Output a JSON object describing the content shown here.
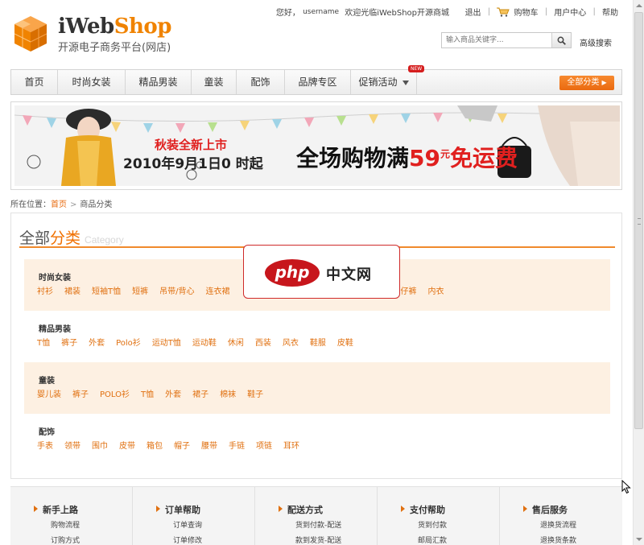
{
  "header": {
    "brand_prefix": "iWeb",
    "brand_suffix": "Shop",
    "subtitle": "开源电子商务平台(网店)",
    "greeting": "您好，",
    "username": "username",
    "welcome": "欢迎光临iWebShop开源商城",
    "links": {
      "logout": "退出",
      "cart": "购物车",
      "user_center": "用户中心",
      "help": "帮助"
    },
    "search": {
      "placeholder": "输入商品关键字...",
      "advanced": "高级搜索"
    }
  },
  "nav": {
    "items": [
      "首页",
      "时尚女装",
      "精品男装",
      "童装",
      "配饰",
      "品牌专区",
      "促销活动"
    ],
    "new_badge": "NEW",
    "all_categories": "全部分类"
  },
  "banner": {
    "line1": "秋装全新上市",
    "line2": "2010年9月1日0 时起",
    "promo_a": "全场购物满",
    "promo_num": "59",
    "promo_unit": "元",
    "promo_b": "免运费"
  },
  "breadcrumb": {
    "label": "所在位置：",
    "home": "首页",
    "current": "商品分类"
  },
  "categories": {
    "title_a": "全部",
    "title_b": "分类",
    "title_en": "Category",
    "groups": [
      {
        "name": "时尚女装",
        "items": [
          "衬衫",
          "裙装",
          "短袖T恤",
          "短裤",
          "吊带/背心",
          "连衣裙",
          "牛仔裤",
          "内衣"
        ]
      },
      {
        "name": "精品男装",
        "items": [
          "T恤",
          "裤子",
          "外套",
          "Polo衫",
          "运动T恤",
          "运动鞋",
          "休闲",
          "西装",
          "风衣",
          "鞋服",
          "皮鞋"
        ]
      },
      {
        "name": "童装",
        "items": [
          "婴儿装",
          "裤子",
          "POLO衫",
          "T恤",
          "外套",
          "裙子",
          "棉袜",
          "鞋子"
        ]
      },
      {
        "name": "配饰",
        "items": [
          "手表",
          "领带",
          "围巾",
          "皮带",
          "箱包",
          "帽子",
          "腰带",
          "手链",
          "项链",
          "耳环"
        ]
      }
    ]
  },
  "watermark": {
    "logo": "php",
    "text": "中文网"
  },
  "footer": {
    "columns": [
      {
        "title": "新手上路",
        "links": [
          "购物流程",
          "订购方式"
        ]
      },
      {
        "title": "订单帮助",
        "links": [
          "订单查询",
          "订单修改"
        ]
      },
      {
        "title": "配送方式",
        "links": [
          "货到付款-配送",
          "款到发货-配送"
        ]
      },
      {
        "title": "支付帮助",
        "links": [
          "货到付款",
          "邮局汇款"
        ]
      },
      {
        "title": "售后服务",
        "links": [
          "退换货流程",
          "退换货条款"
        ]
      }
    ]
  },
  "colors": {
    "accent": "#f08300",
    "link": "#e07010",
    "shade": "#fdf0e2",
    "promo_red": "#e0201f"
  }
}
